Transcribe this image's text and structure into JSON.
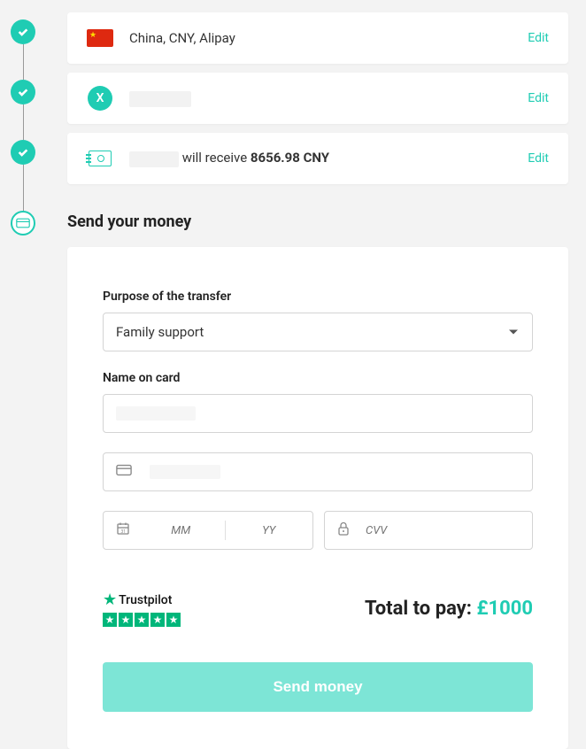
{
  "accent_color": "#1fccb3",
  "summary": {
    "destination": {
      "label": "China, CNY, Alipay",
      "edit": "Edit"
    },
    "recipient": {
      "initial": "X",
      "edit": "Edit"
    },
    "amount": {
      "prefix": "will receive ",
      "value": "8656.98 CNY",
      "edit": "Edit"
    }
  },
  "section_title": "Send your money",
  "form": {
    "purpose_label": "Purpose of the transfer",
    "purpose_value": "Family support",
    "name_on_card_label": "Name on card",
    "mm_placeholder": "MM",
    "yy_placeholder": "YY",
    "cvv_placeholder": "CVV"
  },
  "trustpilot": {
    "label": "Trustpilot",
    "rating_stars": 5
  },
  "total": {
    "label": "Total to pay: ",
    "amount": "£1000"
  },
  "send_button": "Send money"
}
